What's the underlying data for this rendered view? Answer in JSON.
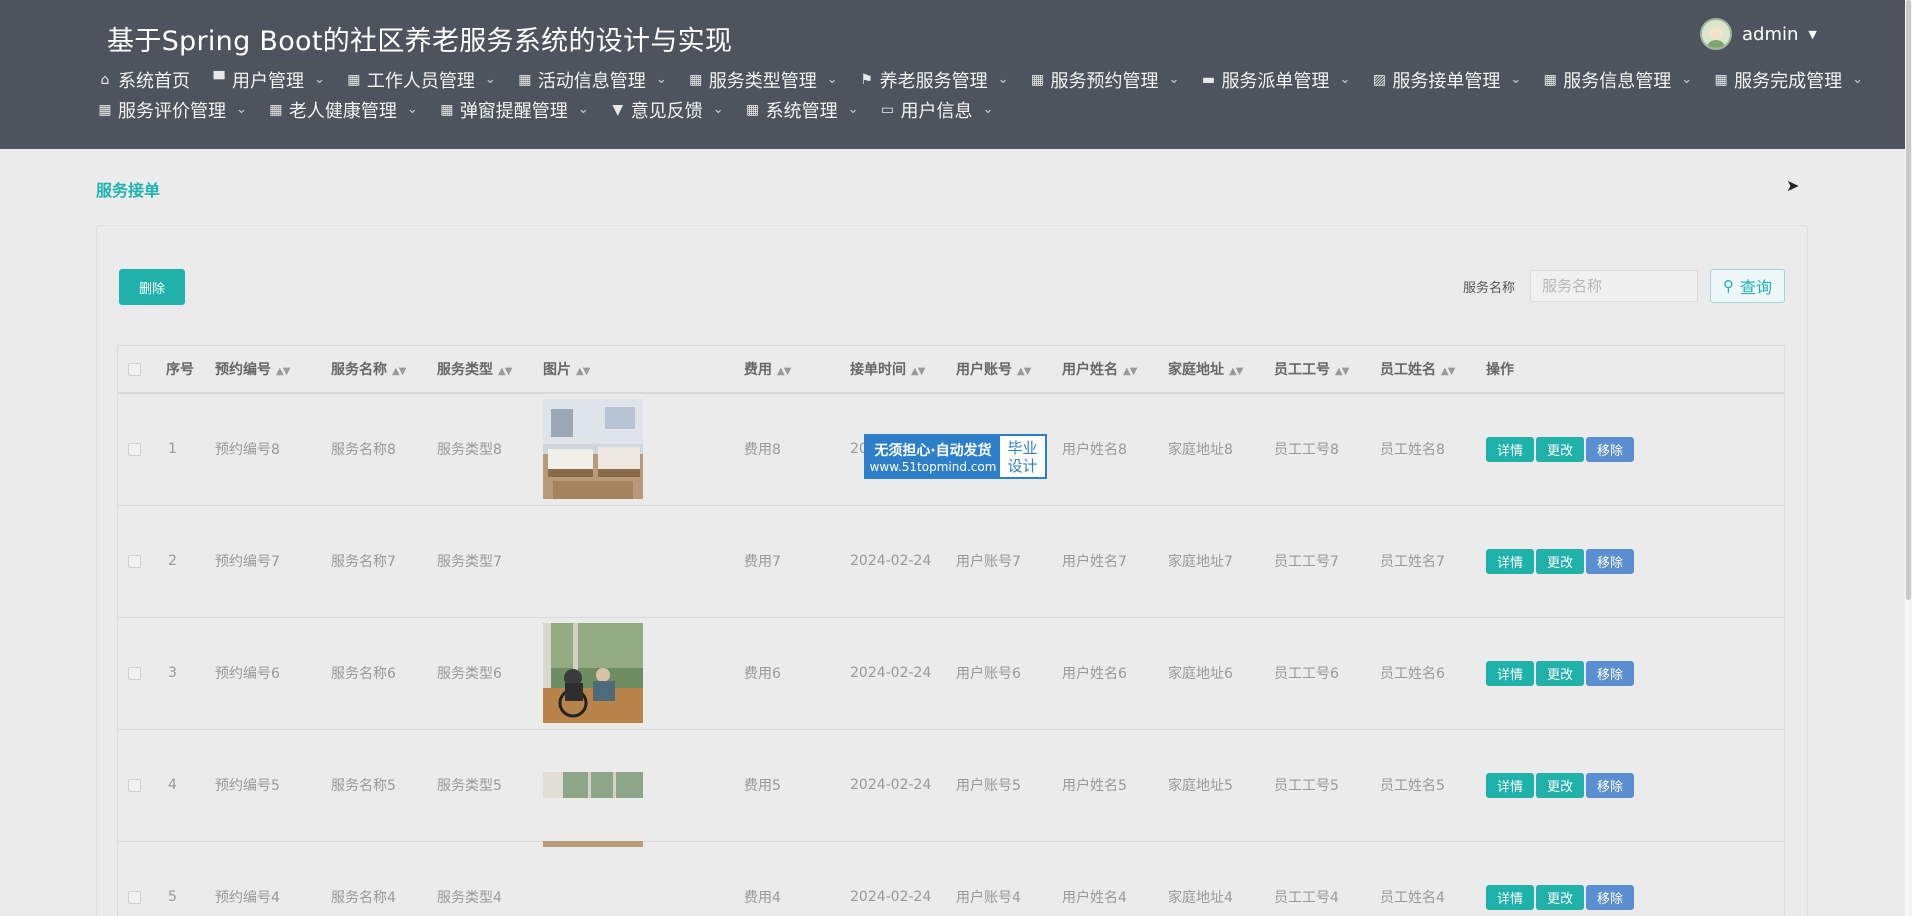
{
  "header": {
    "title": "基于Spring Boot的社区养老服务系统的设计与实现",
    "user": "admin"
  },
  "nav": [
    {
      "label": "系统首页",
      "icon": "home-icon",
      "glyph": "⌂",
      "dropdown": false
    },
    {
      "label": "用户管理",
      "icon": "monitor-icon",
      "glyph": "▀",
      "dropdown": true
    },
    {
      "label": "工作人员管理",
      "icon": "grid-icon",
      "glyph": "▦",
      "dropdown": true
    },
    {
      "label": "活动信息管理",
      "icon": "grid-icon",
      "glyph": "▦",
      "dropdown": true
    },
    {
      "label": "服务类型管理",
      "icon": "grid-icon",
      "glyph": "▦",
      "dropdown": true
    },
    {
      "label": "养老服务管理",
      "icon": "flag-icon",
      "glyph": "⚑",
      "dropdown": true
    },
    {
      "label": "服务预约管理",
      "icon": "grid-icon",
      "glyph": "▦",
      "dropdown": true
    },
    {
      "label": "服务派单管理",
      "icon": "comment-icon",
      "glyph": "▬",
      "dropdown": true
    },
    {
      "label": "服务接单管理",
      "icon": "chart-icon",
      "glyph": "▨",
      "dropdown": true
    },
    {
      "label": "服务信息管理",
      "icon": "grid-icon",
      "glyph": "▦",
      "dropdown": true
    },
    {
      "label": "服务完成管理",
      "icon": "grid-icon",
      "glyph": "▦",
      "dropdown": true
    },
    {
      "label": "服务评价管理",
      "icon": "grid-icon",
      "glyph": "▦",
      "dropdown": true
    },
    {
      "label": "老人健康管理",
      "icon": "grid-icon",
      "glyph": "▦",
      "dropdown": true
    },
    {
      "label": "弹窗提醒管理",
      "icon": "grid-icon",
      "glyph": "▦",
      "dropdown": true
    },
    {
      "label": "意见反馈",
      "icon": "cup-icon",
      "glyph": "▼",
      "dropdown": true
    },
    {
      "label": "系统管理",
      "icon": "grid-icon",
      "glyph": "▦",
      "dropdown": true
    },
    {
      "label": "用户信息",
      "icon": "card-icon",
      "glyph": "▭",
      "dropdown": true
    }
  ],
  "breadcrumb": "服务接单",
  "toolbar": {
    "delete_label": "删除",
    "search_label": "服务名称",
    "search_placeholder": "服务名称",
    "query_label": "查询"
  },
  "table": {
    "headers": [
      "序号",
      "预约编号",
      "服务名称",
      "服务类型",
      "图片",
      "费用",
      "接单时间",
      "用户账号",
      "用户姓名",
      "家庭地址",
      "员工工号",
      "员工姓名",
      "操作"
    ],
    "ops": {
      "detail": "详情",
      "edit": "更改",
      "remove": "移除"
    },
    "rows": [
      {
        "no": "1",
        "code": "预约编号8",
        "service": "服务名称8",
        "type": "服务类型8",
        "image": "bedroom",
        "fee": "费用8",
        "time": "2024-02-24",
        "account": "用户账号8",
        "name": "用户姓名8",
        "address": "家庭地址8",
        "emp_no": "员工工号8",
        "emp_name": "员工姓名8"
      },
      {
        "no": "2",
        "code": "预约编号7",
        "service": "服务名称7",
        "type": "服务类型7",
        "image": "",
        "fee": "费用7",
        "time": "2024-02-24",
        "account": "用户账号7",
        "name": "用户姓名7",
        "address": "家庭地址7",
        "emp_no": "员工工号7",
        "emp_name": "员工姓名7"
      },
      {
        "no": "3",
        "code": "预约编号6",
        "service": "服务名称6",
        "type": "服务类型6",
        "image": "care",
        "fee": "费用6",
        "time": "2024-02-24",
        "account": "用户账号6",
        "name": "用户姓名6",
        "address": "家庭地址6",
        "emp_no": "员工工号6",
        "emp_name": "员工姓名6"
      },
      {
        "no": "4",
        "code": "预约编号5",
        "service": "服务名称5",
        "type": "服务类型5",
        "image": "partial",
        "fee": "费用5",
        "time": "2024-02-24",
        "account": "用户账号5",
        "name": "用户姓名5",
        "address": "家庭地址5",
        "emp_no": "员工工号5",
        "emp_name": "员工姓名5"
      },
      {
        "no": "5",
        "code": "预约编号4",
        "service": "服务名称4",
        "type": "服务类型4",
        "image": "partial-top",
        "fee": "费用4",
        "time": "2024-02-24",
        "account": "用户账号4",
        "name": "用户姓名4",
        "address": "家庭地址4",
        "emp_no": "员工工号4",
        "emp_name": "员工姓名4"
      }
    ]
  },
  "badge": {
    "line1": "无须担心·自动发货",
    "line2": "www.51topmind.com",
    "right1": "毕业",
    "right2": "设计"
  },
  "colors": {
    "header_bg": "#4e545e",
    "accent": "#20b2aa",
    "remove": "#5b8ed0"
  }
}
